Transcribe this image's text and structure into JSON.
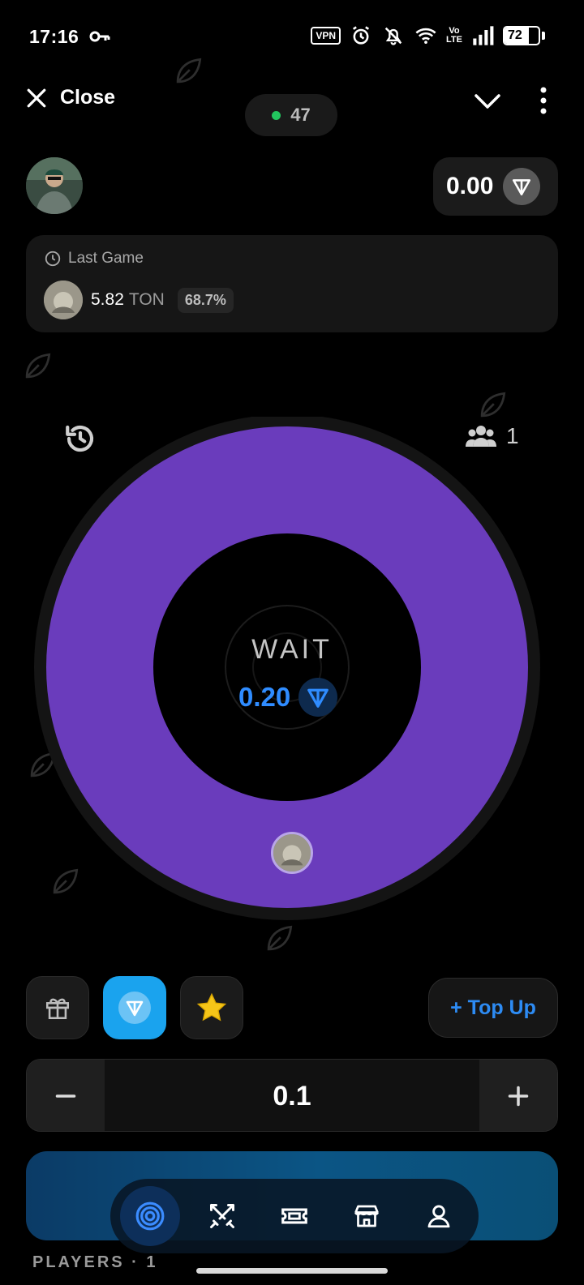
{
  "status_bar": {
    "time": "17:16",
    "vpn": "VPN",
    "volte_top": "Vo",
    "volte_bottom": "LTE",
    "battery": "72",
    "battery_level": 0.72
  },
  "header": {
    "close_label": "Close",
    "online_count": "47",
    "online_color": "#22c55e"
  },
  "balance": {
    "value": "0.00",
    "currency_icon": "ton-icon"
  },
  "last_game": {
    "title": "Last Game",
    "amount": "5.82",
    "currency": "TON",
    "chance": "68.7%"
  },
  "wheel": {
    "status": "WAIT",
    "pot": "0.20",
    "players": "1",
    "segment_color": "#6a3cbc",
    "segments": [
      {
        "share": 1.0,
        "color": "#6a3cbc"
      }
    ]
  },
  "currency_selector": {
    "options": [
      "gift-icon",
      "ton-icon",
      "star-icon"
    ],
    "selected": "ton",
    "topup_label": "+ Top Up"
  },
  "stepper": {
    "value": "0.1",
    "minus": "−",
    "plus": "+"
  },
  "nav": {
    "items": [
      "target-icon",
      "crossed-swords-icon",
      "ticket-icon",
      "store-icon",
      "profile-icon"
    ],
    "active": "target-icon"
  },
  "footer": {
    "players_label": "PLAYERS · 1"
  },
  "colors": {
    "accent_blue": "#2d8bf3",
    "ton_blue": "#1aa3ee",
    "wheel_purple": "#6a3cbc"
  }
}
